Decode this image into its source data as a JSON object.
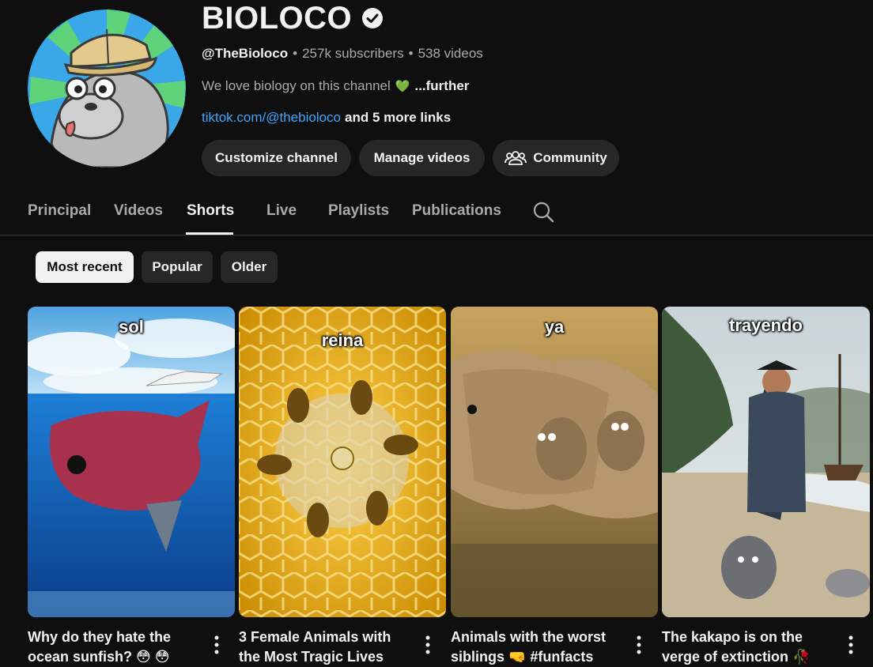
{
  "channel": {
    "name": "BIOLOCO",
    "handle": "@TheBioloco",
    "subscribers": "257k subscribers",
    "videos": "538 videos",
    "description": "We love biology on this channel",
    "more": "...further",
    "link": "tiktok.com/@thebioloco",
    "more_links": "and 5 more links"
  },
  "buttons": {
    "customize": "Customize channel",
    "manage": "Manage videos",
    "community": "Community"
  },
  "tabs": [
    {
      "label": "Principal",
      "active": false
    },
    {
      "label": "Videos",
      "active": false
    },
    {
      "label": "Shorts",
      "active": true
    },
    {
      "label": "Live",
      "active": false
    },
    {
      "label": "Playlists",
      "active": false
    },
    {
      "label": "Publications",
      "active": false
    }
  ],
  "chips": [
    {
      "label": "Most recent",
      "selected": true
    },
    {
      "label": "Popular",
      "selected": false
    },
    {
      "label": "Older",
      "selected": false
    }
  ],
  "shorts": [
    {
      "overlay": "sol",
      "title_line1": "Why do they hate the",
      "title_line2": "ocean sunfish? 😳 😳"
    },
    {
      "overlay": "reina",
      "title_line1": "3 Female Animals with",
      "title_line2": "the Most Tragic Lives"
    },
    {
      "overlay": "ya",
      "title_line1": "Animals with the worst",
      "title_line2": "siblings 🤜 #funfacts"
    },
    {
      "overlay": "trayendo",
      "title_line1": "The kakapo is on the",
      "title_line2": "verge of extinction 🥀"
    }
  ],
  "icons": {
    "verified": "verified-badge-icon",
    "community": "people-icon",
    "search": "search-icon",
    "kebab": "more-vert-icon"
  },
  "colors": {
    "background": "#0f0f0f",
    "button": "#272727",
    "link": "#3ea6ff",
    "secondary_text": "#aaaaaa"
  }
}
